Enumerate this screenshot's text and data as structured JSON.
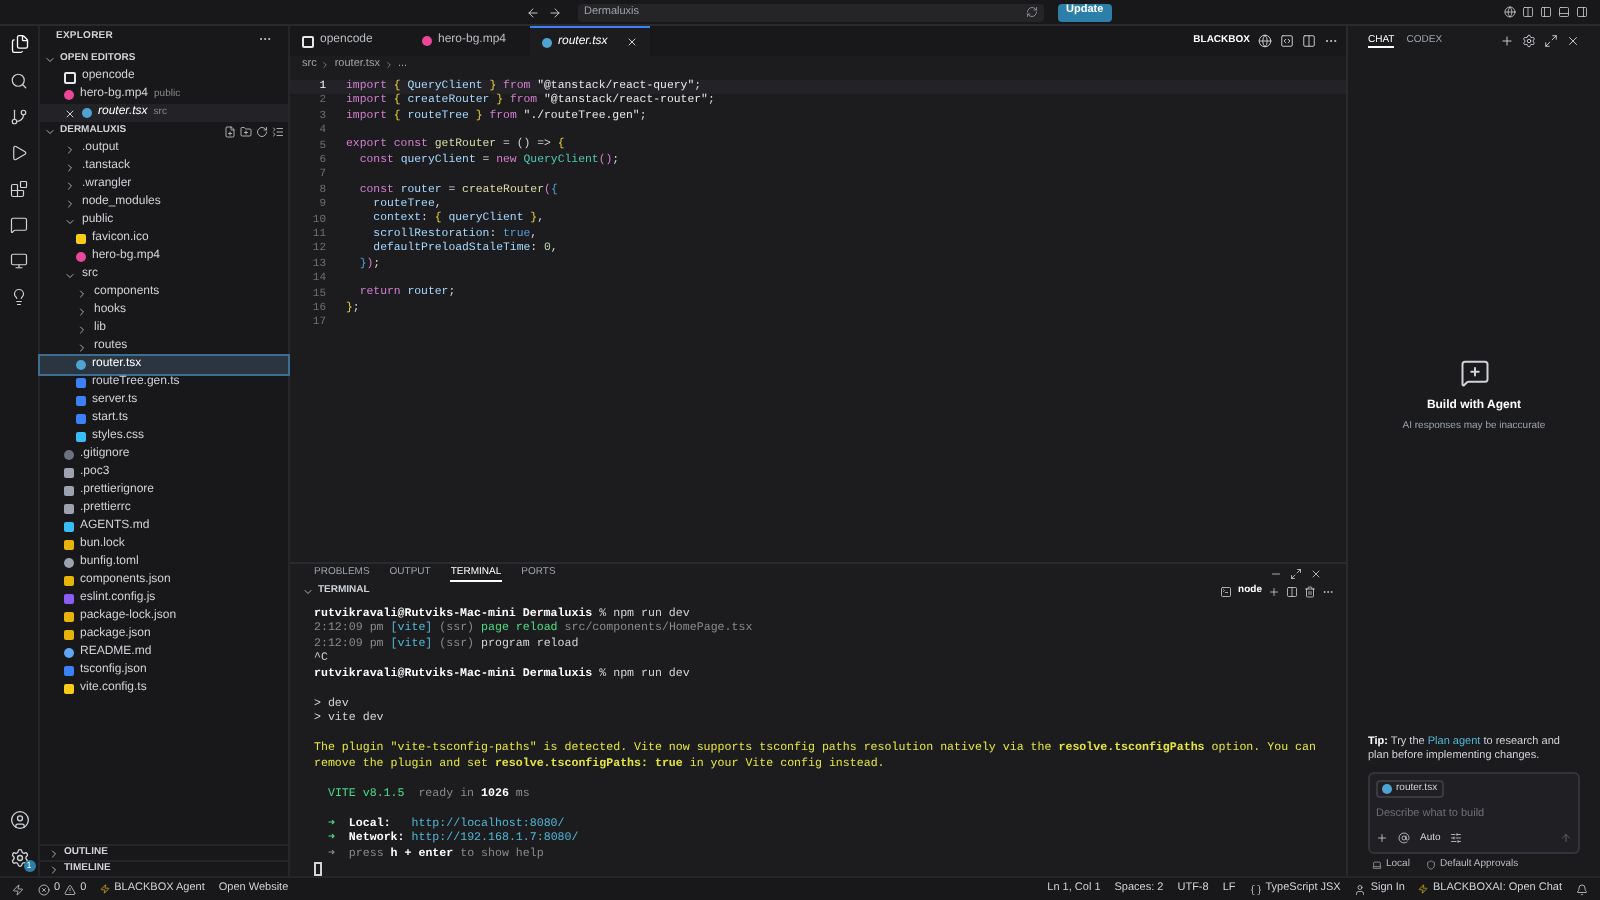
{
  "title_bar": {
    "search": "Dermaluxis",
    "update_button": "Update"
  },
  "activity_bar": {
    "badge": "1"
  },
  "sidebar": {
    "title": "EXPLORER",
    "open_editors": {
      "title": "OPEN EDITORS",
      "expanded": true,
      "items": [
        {
          "name": "opencode",
          "kind": "app",
          "selected": false
        },
        {
          "name": "hero-bg.mp4",
          "description": "public",
          "kind": "video",
          "selected": false
        },
        {
          "name": "router.tsx",
          "description": "src",
          "kind": "tsx",
          "selected": true
        }
      ]
    },
    "project": {
      "title": "DERMALUXIS",
      "expanded": true,
      "items": [
        {
          "name": ".output",
          "kind": "folder",
          "expanded": false,
          "selected": false
        },
        {
          "name": ".tanstack",
          "kind": "folder",
          "expanded": false,
          "selected": false
        },
        {
          "name": ".wrangler",
          "kind": "folder",
          "expanded": false,
          "selected": false
        },
        {
          "name": "node_modules",
          "kind": "folder",
          "expanded": false,
          "selected": false
        },
        {
          "name": "public",
          "kind": "folder",
          "expanded": true,
          "selected": false,
          "children": [
            {
              "name": "favicon.ico",
              "kind": "ico",
              "selected": false
            },
            {
              "name": "hero-bg.mp4",
              "kind": "video",
              "selected": false
            }
          ]
        },
        {
          "name": "src",
          "kind": "folder",
          "expanded": true,
          "selected": false,
          "children": [
            {
              "name": "components",
              "kind": "folder",
              "expanded": false,
              "selected": false
            },
            {
              "name": "hooks",
              "kind": "folder",
              "expanded": false,
              "selected": false
            },
            {
              "name": "lib",
              "kind": "folder",
              "expanded": false,
              "selected": false
            },
            {
              "name": "routes",
              "kind": "folder",
              "expanded": false,
              "selected": false
            },
            {
              "name": "router.tsx",
              "kind": "tsx",
              "selected": true
            },
            {
              "name": "routeTree.gen.ts",
              "kind": "ts",
              "selected": false
            },
            {
              "name": "server.ts",
              "kind": "ts",
              "selected": false
            },
            {
              "name": "start.ts",
              "kind": "ts",
              "selected": false
            },
            {
              "name": "styles.css",
              "kind": "css",
              "selected": false
            }
          ]
        },
        {
          "name": ".gitignore",
          "kind": "git",
          "selected": false
        },
        {
          "name": ".poc3",
          "kind": "text",
          "selected": false
        },
        {
          "name": ".prettierignore",
          "kind": "text",
          "selected": false
        },
        {
          "name": ".prettierrc",
          "kind": "text",
          "selected": false
        },
        {
          "name": "AGENTS.md",
          "kind": "md",
          "selected": false
        },
        {
          "name": "bun.lock",
          "kind": "json",
          "selected": false
        },
        {
          "name": "bunfig.toml",
          "kind": "gear",
          "selected": false
        },
        {
          "name": "components.json",
          "kind": "json",
          "selected": false
        },
        {
          "name": "eslint.config.js",
          "kind": "eslint",
          "selected": false
        },
        {
          "name": "package-lock.json",
          "kind": "json",
          "selected": false
        },
        {
          "name": "package.json",
          "kind": "json",
          "selected": false
        },
        {
          "name": "README.md",
          "kind": "info",
          "selected": false
        },
        {
          "name": "tsconfig.json",
          "kind": "tsconfig",
          "selected": false
        },
        {
          "name": "vite.config.ts",
          "kind": "vite",
          "selected": false
        }
      ]
    },
    "sections": [
      {
        "title": "OUTLINE",
        "expanded": false
      },
      {
        "title": "TIMELINE",
        "expanded": false
      }
    ]
  },
  "editor": {
    "tabs": [
      {
        "label": "opencode",
        "kind": "app",
        "selected": false
      },
      {
        "label": "hero-bg.mp4",
        "kind": "video",
        "selected": false
      },
      {
        "label": "router.tsx",
        "kind": "tsx",
        "selected": true
      }
    ],
    "toolbar_label": "BLACKBOX",
    "breadcrumb": [
      "src",
      "router.tsx",
      "..."
    ],
    "lines": [
      {
        "number": "1",
        "current": true,
        "tokens": [
          {
            "text": "import ",
            "kind": "kw"
          },
          {
            "text": "{ ",
            "kind": "brace"
          },
          {
            "text": "QueryClient ",
            "kind": "ident"
          },
          {
            "text": "} ",
            "kind": "brace"
          },
          {
            "text": "from ",
            "kind": "kw"
          },
          {
            "text": "\"@tanstack/react-query\"",
            "kind": "str"
          },
          {
            "text": ";",
            "kind": "plain"
          }
        ]
      },
      {
        "number": "2",
        "current": false,
        "tokens": [
          {
            "text": "import ",
            "kind": "kw"
          },
          {
            "text": "{ ",
            "kind": "brace"
          },
          {
            "text": "createRouter ",
            "kind": "ident"
          },
          {
            "text": "} ",
            "kind": "brace"
          },
          {
            "text": "from ",
            "kind": "kw"
          },
          {
            "text": "\"@tanstack/react-router\"",
            "kind": "str"
          },
          {
            "text": ";",
            "kind": "plain"
          }
        ]
      },
      {
        "number": "3",
        "current": false,
        "tokens": [
          {
            "text": "import ",
            "kind": "kw"
          },
          {
            "text": "{ ",
            "kind": "brace"
          },
          {
            "text": "routeTree ",
            "kind": "ident"
          },
          {
            "text": "} ",
            "kind": "brace"
          },
          {
            "text": "from ",
            "kind": "kw"
          },
          {
            "text": "\"./routeTree.gen\"",
            "kind": "str"
          },
          {
            "text": ";",
            "kind": "plain"
          }
        ]
      },
      {
        "number": "4",
        "current": false
      },
      {
        "number": "5",
        "current": false,
        "tokens": [
          {
            "text": "export const ",
            "kind": "kw"
          },
          {
            "text": "getRouter",
            "kind": "fn"
          },
          {
            "text": " = () => ",
            "kind": "plain"
          },
          {
            "text": "{",
            "kind": "brace"
          }
        ]
      },
      {
        "number": "6",
        "current": false,
        "tokens": [
          {
            "text": "  const ",
            "kind": "kw"
          },
          {
            "text": "queryClient",
            "kind": "ident"
          },
          {
            "text": " = ",
            "kind": "plain"
          },
          {
            "text": "new ",
            "kind": "kw"
          },
          {
            "text": "QueryClient",
            "kind": "cls"
          },
          {
            "text": "()",
            "kind": "brace2"
          },
          {
            "text": ";",
            "kind": "plain"
          }
        ]
      },
      {
        "number": "7",
        "current": false
      },
      {
        "number": "8",
        "current": false,
        "tokens": [
          {
            "text": "  const ",
            "kind": "kw"
          },
          {
            "text": "router",
            "kind": "ident"
          },
          {
            "text": " = ",
            "kind": "plain"
          },
          {
            "text": "createRouter",
            "kind": "fn"
          },
          {
            "text": "(",
            "kind": "brace2"
          },
          {
            "text": "{",
            "kind": "brace3"
          }
        ]
      },
      {
        "number": "9",
        "current": false,
        "tokens": [
          {
            "text": "    routeTree",
            "kind": "ident"
          },
          {
            "text": ",",
            "kind": "plain"
          }
        ]
      },
      {
        "number": "10",
        "current": false,
        "tokens": [
          {
            "text": "    context",
            "kind": "ident"
          },
          {
            "text": ": ",
            "kind": "plain"
          },
          {
            "text": "{ ",
            "kind": "brace"
          },
          {
            "text": "queryClient ",
            "kind": "ident"
          },
          {
            "text": "}",
            "kind": "brace"
          },
          {
            "text": ",",
            "kind": "plain"
          }
        ]
      },
      {
        "number": "11",
        "current": false,
        "tokens": [
          {
            "text": "    scrollRestoration",
            "kind": "ident"
          },
          {
            "text": ": ",
            "kind": "plain"
          },
          {
            "text": "true",
            "kind": "bool"
          },
          {
            "text": ",",
            "kind": "plain"
          }
        ]
      },
      {
        "number": "12",
        "current": false,
        "tokens": [
          {
            "text": "    defaultPreloadStaleTime",
            "kind": "ident"
          },
          {
            "text": ": ",
            "kind": "plain"
          },
          {
            "text": "0",
            "kind": "num"
          },
          {
            "text": ",",
            "kind": "plain"
          }
        ]
      },
      {
        "number": "13",
        "current": false,
        "tokens": [
          {
            "text": "  }",
            "kind": "brace3"
          },
          {
            "text": ")",
            "kind": "brace2"
          },
          {
            "text": ";",
            "kind": "plain"
          }
        ]
      },
      {
        "number": "14",
        "current": false
      },
      {
        "number": "15",
        "current": false,
        "tokens": [
          {
            "text": "  return ",
            "kind": "kw"
          },
          {
            "text": "router",
            "kind": "ident"
          },
          {
            "text": ";",
            "kind": "plain"
          }
        ]
      },
      {
        "number": "16",
        "current": false,
        "tokens": [
          {
            "text": "}",
            "kind": "brace"
          },
          {
            "text": ";",
            "kind": "plain"
          }
        ]
      },
      {
        "number": "17",
        "current": false
      }
    ]
  },
  "panel": {
    "tabs": [
      {
        "label": "PROBLEMS",
        "selected": false
      },
      {
        "label": "OUTPUT",
        "selected": false
      },
      {
        "label": "TERMINAL",
        "selected": true
      },
      {
        "label": "PORTS",
        "selected": false
      }
    ],
    "header": "TERMINAL",
    "shell": "node",
    "lines": [
      {
        "kind": "text",
        "tokens": [
          {
            "text": "rutvikravali@Rutviks-Mac-mini Dermaluxis",
            "kind": "bold"
          },
          {
            "text": " % npm run dev",
            "kind": "plain"
          }
        ]
      },
      {
        "kind": "text",
        "tokens": [
          {
            "text": "2:12:09 pm ",
            "kind": "dim"
          },
          {
            "text": "[vite] ",
            "kind": "cyan"
          },
          {
            "text": "(ssr) ",
            "kind": "dim"
          },
          {
            "text": "page reload ",
            "kind": "green"
          },
          {
            "text": "src/components/HomePage.tsx",
            "kind": "dim"
          }
        ]
      },
      {
        "kind": "text",
        "tokens": [
          {
            "text": "2:12:09 pm ",
            "kind": "dim"
          },
          {
            "text": "[vite] ",
            "kind": "cyan"
          },
          {
            "text": "(ssr) ",
            "kind": "dim"
          },
          {
            "text": "program reload",
            "kind": "plain"
          }
        ]
      },
      {
        "kind": "text",
        "tokens": [
          {
            "text": "^C",
            "kind": "plain"
          }
        ]
      },
      {
        "kind": "text",
        "tokens": [
          {
            "text": "rutvikravali@Rutviks-Mac-mini Dermaluxis",
            "kind": "bold"
          },
          {
            "text": " % npm run dev",
            "kind": "plain"
          }
        ]
      },
      {
        "kind": "blank"
      },
      {
        "kind": "text",
        "tokens": [
          {
            "text": "> dev",
            "kind": "plain"
          }
        ]
      },
      {
        "kind": "text",
        "tokens": [
          {
            "text": "> vite dev",
            "kind": "plain"
          }
        ]
      },
      {
        "kind": "blank"
      },
      {
        "kind": "text",
        "tokens": [
          {
            "text": "The plugin \"vite-tsconfig-paths\" is detected. Vite now supports tsconfig paths resolution natively via the ",
            "kind": "yellow"
          },
          {
            "text": "resolve.tsconfigPaths",
            "kind": "yellowbold"
          },
          {
            "text": " option. You can remove the plugin and set ",
            "kind": "yellow"
          },
          {
            "text": "resolve.tsconfigPaths: true",
            "kind": "yellowbold"
          },
          {
            "text": " in your Vite config instead.",
            "kind": "yellow"
          }
        ]
      },
      {
        "kind": "blank"
      },
      {
        "kind": "text",
        "tokens": [
          {
            "text": "  VITE v8.1.5",
            "kind": "green"
          },
          {
            "text": "  ready in ",
            "kind": "dim"
          },
          {
            "text": "1026",
            "kind": "bold"
          },
          {
            "text": " ms",
            "kind": "dim"
          }
        ]
      },
      {
        "kind": "blank"
      },
      {
        "kind": "text",
        "tokens": [
          {
            "text": "  ➜  ",
            "kind": "green"
          },
          {
            "text": "Local:",
            "kind": "bold"
          },
          {
            "text": "   http://localhost:8080/",
            "kind": "cyan"
          }
        ]
      },
      {
        "kind": "text",
        "tokens": [
          {
            "text": "  ➜  ",
            "kind": "green"
          },
          {
            "text": "Network:",
            "kind": "bold"
          },
          {
            "text": " http://192.168.1.7:8080/",
            "kind": "cyan"
          }
        ]
      },
      {
        "kind": "text",
        "tokens": [
          {
            "text": "  ➜  press ",
            "kind": "dim"
          },
          {
            "text": "h + enter",
            "kind": "bold"
          },
          {
            "text": " to show help",
            "kind": "dim"
          }
        ]
      },
      {
        "kind": "cursor"
      }
    ]
  },
  "chat": {
    "tabs": [
      {
        "label": "CHAT",
        "selected": true
      },
      {
        "label": "CODEX",
        "selected": false
      }
    ],
    "empty_title": "Build with Agent",
    "empty_subtitle": "AI responses may be inaccurate",
    "tip": {
      "label": "Tip:",
      "before": "Try the",
      "link": "Plan agent",
      "after": "to research and plan before implementing changes."
    },
    "context_chip": "router.tsx",
    "placeholder": "Describe what to build",
    "mode": "Auto",
    "footer": [
      "Local",
      "Default Approvals"
    ]
  },
  "status_bar": {
    "errors": "0",
    "warnings": "0",
    "left": [
      "BLACKBOX Agent",
      "Open Website"
    ],
    "right": [
      "Ln 1, Col 1",
      "Spaces: 2",
      "UTF-8",
      "LF"
    ],
    "language": "TypeScript JSX",
    "sign_in": "Sign In",
    "chat": "BLACKBOXAI: Open Chat"
  }
}
